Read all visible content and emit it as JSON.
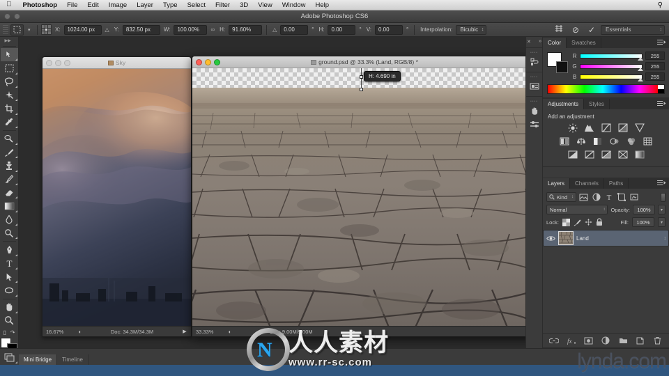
{
  "macmenu": {
    "apple_icon": "apple-icon",
    "items": [
      {
        "label": "Photoshop",
        "bold": true
      },
      {
        "label": "File",
        "bold": false
      },
      {
        "label": "Edit",
        "bold": false
      },
      {
        "label": "Image",
        "bold": false
      },
      {
        "label": "Layer",
        "bold": false
      },
      {
        "label": "Type",
        "bold": false
      },
      {
        "label": "Select",
        "bold": false
      },
      {
        "label": "Filter",
        "bold": false
      },
      {
        "label": "3D",
        "bold": false
      },
      {
        "label": "View",
        "bold": false
      },
      {
        "label": "Window",
        "bold": false
      },
      {
        "label": "Help",
        "bold": false
      }
    ],
    "search_icon": "search-icon"
  },
  "app": {
    "title": "Adobe Photoshop CS6"
  },
  "options": {
    "tool_icon": "move-tool-icon",
    "reference_point_label": "reference-point-grid",
    "x_label": "X:",
    "x_value": "1024.00 px",
    "delta_icon": "triangle-delta-icon",
    "y_label": "Y:",
    "y_value": "832.50 px",
    "w_label": "W:",
    "w_value": "100.00%",
    "link_icon": "chain-link-icon",
    "h_label": "H:",
    "h_value": "91.60%",
    "angle_icon": "angle-icon",
    "angle_value": "0.00",
    "degree": "°",
    "skew_h_label": "H:",
    "skew_h_value": "0.00",
    "skew_v_label": "V:",
    "skew_v_value": "0.00",
    "interpolation_label": "Interpolation:",
    "interpolation_value": "Bicubic",
    "warp_icon": "warp-mode-icon",
    "cancel_icon": "cancel-transform-icon",
    "commit_icon": "commit-transform-icon",
    "workspace": "Essentials"
  },
  "toolbox": {
    "tools_top": [
      {
        "name": "move-tool",
        "selected": true
      },
      {
        "name": "rectangular-marquee-tool",
        "selected": false
      },
      {
        "name": "lasso-tool",
        "selected": false
      },
      {
        "name": "quick-selection-tool",
        "selected": false
      },
      {
        "name": "crop-tool",
        "selected": false
      },
      {
        "name": "eyedropper-tool",
        "selected": false
      }
    ],
    "tools_mid": [
      {
        "name": "spot-healing-brush-tool",
        "selected": false
      },
      {
        "name": "brush-tool",
        "selected": false
      },
      {
        "name": "clone-stamp-tool",
        "selected": false
      },
      {
        "name": "history-brush-tool",
        "selected": false
      },
      {
        "name": "eraser-tool",
        "selected": false
      },
      {
        "name": "gradient-tool",
        "selected": false
      },
      {
        "name": "blur-tool",
        "selected": false
      },
      {
        "name": "dodge-tool",
        "selected": false
      }
    ],
    "tools_bot": [
      {
        "name": "pen-tool",
        "selected": false
      },
      {
        "name": "horizontal-type-tool",
        "selected": false
      },
      {
        "name": "path-selection-tool",
        "selected": false
      },
      {
        "name": "ellipse-shape-tool",
        "selected": false
      }
    ],
    "tools_nav": [
      {
        "name": "hand-tool",
        "selected": false
      },
      {
        "name": "zoom-tool",
        "selected": false
      }
    ],
    "foreground_color": "#ffffff",
    "background_color": "#000000",
    "quick_mask_icon": "quick-mask-icon"
  },
  "documents": {
    "background": {
      "title": "Sky",
      "file_icon": "document-icon",
      "zoom": "16.67%",
      "doc_size": "Doc: 34.3M/34.3M",
      "status_icon": "status-clock-icon",
      "arrow_icon": "play-arrow-icon"
    },
    "active": {
      "title": "ground.psd @ 33.3% (Land, RGB/8) *",
      "file_icon": "document-icon",
      "zoom": "33.33%",
      "doc_size": "Doc: 9.00M/9.00M",
      "status_icon": "status-clock-icon",
      "arrow_icon": "play-arrow-icon",
      "hud_value": "H: 4.690 in",
      "resize_icon": "resize-grip-icon"
    }
  },
  "icon_dock": {
    "expand_icon": "expand-panels-icon",
    "collapse_icon": "collapse-panels-icon",
    "icons": [
      {
        "name": "history-panel-icon"
      },
      {
        "name": "properties-panel-icon"
      },
      {
        "name": "hand-panel-icon"
      },
      {
        "name": "adjustments-strip-icon"
      }
    ]
  },
  "color_panel": {
    "tabs": [
      {
        "label": "Color",
        "active": true
      },
      {
        "label": "Swatches",
        "active": false
      }
    ],
    "menu_icon": "panel-menu-icon",
    "sliders": [
      {
        "name": "R",
        "value": "255"
      },
      {
        "name": "G",
        "value": "255"
      },
      {
        "name": "B",
        "value": "255"
      }
    ],
    "foreground": "#ffffff",
    "background": "#000000"
  },
  "adjustments_panel": {
    "tabs": [
      {
        "label": "Adjustments",
        "active": true
      },
      {
        "label": "Styles",
        "active": false
      }
    ],
    "menu_icon": "panel-menu-icon",
    "heading": "Add an adjustment",
    "row1": [
      {
        "name": "brightness-contrast-icon"
      },
      {
        "name": "levels-icon"
      },
      {
        "name": "curves-icon"
      },
      {
        "name": "exposure-icon"
      },
      {
        "name": "vibrance-icon"
      }
    ],
    "row2": [
      {
        "name": "hue-saturation-icon"
      },
      {
        "name": "color-balance-icon"
      },
      {
        "name": "black-white-icon"
      },
      {
        "name": "photo-filter-icon"
      },
      {
        "name": "channel-mixer-icon"
      },
      {
        "name": "color-lookup-icon"
      }
    ],
    "row3": [
      {
        "name": "invert-icon"
      },
      {
        "name": "posterize-icon"
      },
      {
        "name": "threshold-icon"
      },
      {
        "name": "selective-color-icon"
      },
      {
        "name": "gradient-map-icon"
      }
    ]
  },
  "layers_panel": {
    "tabs": [
      {
        "label": "Layers",
        "active": true
      },
      {
        "label": "Channels",
        "active": false
      },
      {
        "label": "Paths",
        "active": false
      }
    ],
    "menu_icon": "panel-menu-icon",
    "filter_label": "Kind",
    "filter_icon": "search-icon",
    "filter_types": [
      {
        "name": "filter-pixel-icon"
      },
      {
        "name": "filter-adjustment-icon"
      },
      {
        "name": "filter-type-icon"
      },
      {
        "name": "filter-shape-icon"
      },
      {
        "name": "filter-smart-object-icon"
      }
    ],
    "blend_mode": "Normal",
    "opacity_label": "Opacity:",
    "opacity_value": "100%",
    "lock_label": "Lock:",
    "locks": [
      {
        "name": "lock-transparent-pixels-icon"
      },
      {
        "name": "lock-image-pixels-icon"
      },
      {
        "name": "lock-position-icon"
      },
      {
        "name": "lock-all-icon"
      }
    ],
    "fill_label": "Fill:",
    "fill_value": "100%",
    "layers": [
      {
        "name": "Land",
        "visible": true,
        "selected": true
      }
    ],
    "footer": [
      {
        "name": "link-layers-icon"
      },
      {
        "name": "layer-style-fx-icon"
      },
      {
        "name": "add-layer-mask-icon"
      },
      {
        "name": "new-adjustment-layer-icon"
      },
      {
        "name": "new-group-icon"
      },
      {
        "name": "new-layer-icon"
      },
      {
        "name": "delete-layer-icon"
      }
    ]
  },
  "bottom_bar": {
    "bridge_icon": "mini-bridge-launch-icon",
    "tabs": [
      {
        "label": "Mini Bridge",
        "active": true
      },
      {
        "label": "Timeline",
        "active": false
      }
    ]
  },
  "watermarks": {
    "cn_logo_letter": "N",
    "cn_text": "人人素材",
    "cn_url": "www.rr-sc.com",
    "lynda": "lynda.com"
  }
}
